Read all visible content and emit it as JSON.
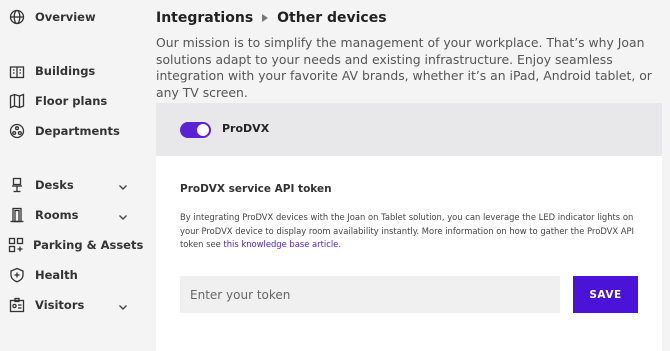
{
  "sidebar": {
    "items": [
      {
        "label": "Overview",
        "icon": "globe-icon"
      },
      {
        "label": "Buildings",
        "icon": "buildings-icon"
      },
      {
        "label": "Floor plans",
        "icon": "map-icon"
      },
      {
        "label": "Departments",
        "icon": "departments-icon"
      },
      {
        "label": "Desks",
        "icon": "desk-chair-icon",
        "expandable": true
      },
      {
        "label": "Rooms",
        "icon": "door-icon",
        "expandable": true
      },
      {
        "label": "Parking & Assets",
        "icon": "assets-grid-icon"
      },
      {
        "label": "Health",
        "icon": "health-shield-icon"
      },
      {
        "label": "Visitors",
        "icon": "visitor-badge-icon",
        "expandable": true
      }
    ]
  },
  "breadcrumb": {
    "parent": "Integrations",
    "current": "Other devices"
  },
  "intro_text": "Our mission is to simplify the management of your workplace. That’s why Joan solutions adapt to your needs and existing infrastructure. Enjoy seamless integration with your favorite AV brands, whether it’s an iPad, Android tablet, or any TV screen.",
  "integration": {
    "name": "ProDVX",
    "enabled": true
  },
  "panel": {
    "title": "ProDVX service API token",
    "description": "By integrating ProDVX devices with the Joan on Tablet solution, you can leverage the LED indicator lights on your ProDVX device to display room availability instantly. More information on how to gather the ProDVX API token see ",
    "link_text": "this knowledge base article",
    "description_end": ".",
    "input_placeholder": "Enter your token",
    "input_value": "",
    "save_label": "SAVE"
  },
  "colors": {
    "accent": "#4b12d8",
    "toggle_on": "#5b21d4",
    "background": "#f4f4f4"
  }
}
